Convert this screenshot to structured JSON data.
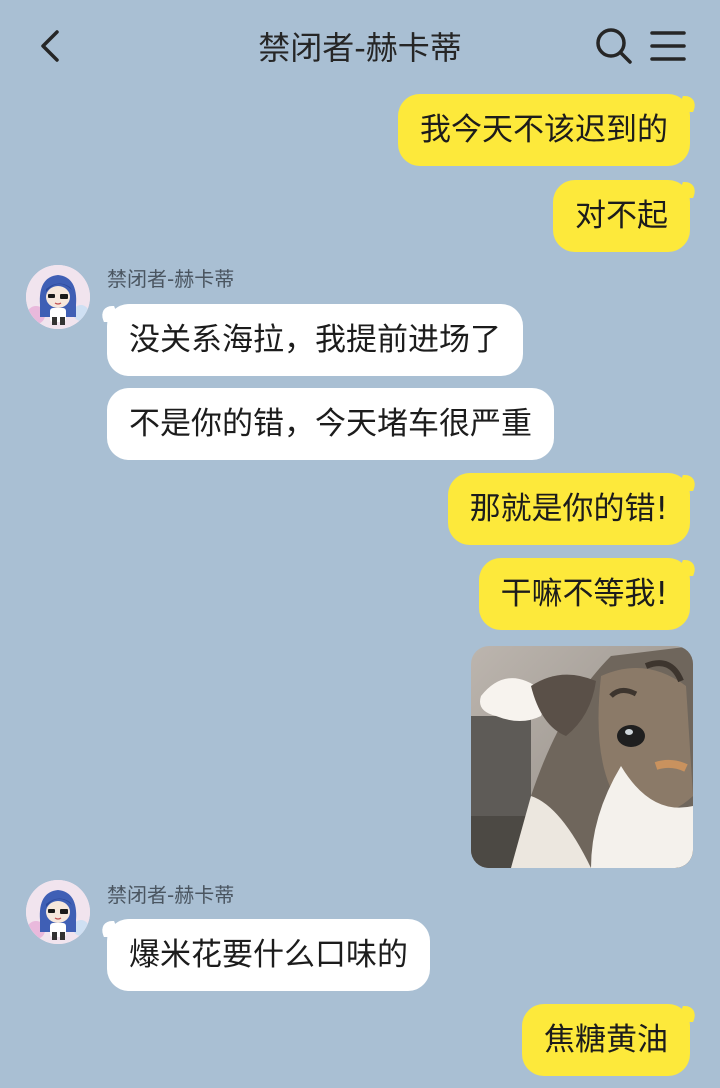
{
  "header": {
    "title": "禁闭者-赫卡蒂",
    "back_icon": "chevron-left-icon",
    "search_icon": "search-icon",
    "menu_icon": "menu-icon"
  },
  "messages": [
    {
      "from": "me",
      "text": "我今天不该迟到的"
    },
    {
      "from": "me",
      "text": "对不起"
    },
    {
      "from": "them",
      "sender": "禁闭者-赫卡蒂",
      "text": "没关系海拉，我提前进场了"
    },
    {
      "from": "them",
      "text": "不是你的错，今天堵车很严重"
    },
    {
      "from": "me",
      "text": "那就是你的错!"
    },
    {
      "from": "me",
      "text": "干嘛不等我!"
    },
    {
      "from": "me",
      "type": "image"
    },
    {
      "from": "them",
      "sender": "禁闭者-赫卡蒂",
      "text": "爆米花要什么口味的"
    },
    {
      "from": "me",
      "text": "焦糖黄油"
    }
  ],
  "colors": {
    "background": "#a9bfd3",
    "my_bubble": "#fde93b",
    "their_bubble": "#ffffff"
  }
}
